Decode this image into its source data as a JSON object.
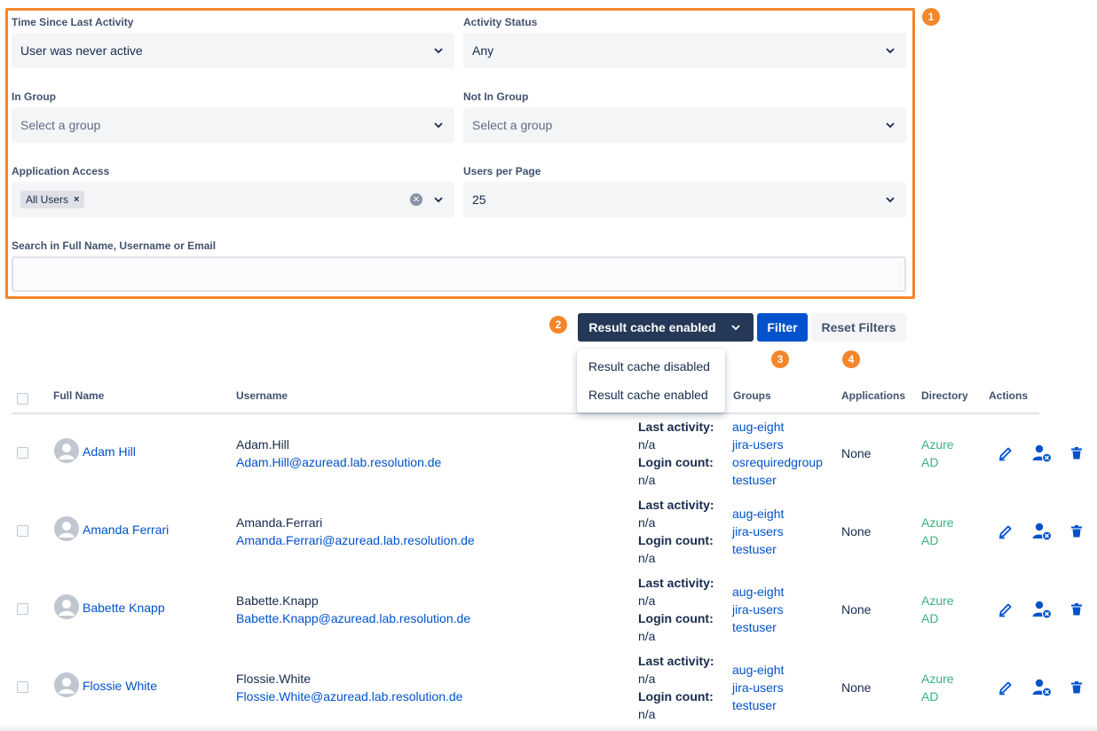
{
  "filters": {
    "time_since": {
      "label": "Time Since Last Activity",
      "value": "User was never active"
    },
    "activity_status": {
      "label": "Activity Status",
      "value": "Any"
    },
    "in_group": {
      "label": "In Group",
      "placeholder": "Select a group"
    },
    "not_in_group": {
      "label": "Not In Group",
      "placeholder": "Select a group"
    },
    "app_access": {
      "label": "Application Access",
      "chip": "All Users",
      "chip_remove": "×"
    },
    "users_per_page": {
      "label": "Users per Page",
      "value": "25"
    },
    "search": {
      "label": "Search in Full Name, Username or Email",
      "value": ""
    }
  },
  "callouts": [
    "1",
    "2",
    "3",
    "4"
  ],
  "toolbar": {
    "cache_button": "Result cache enabled",
    "filter_button": "Filter",
    "reset_button": "Reset Filters"
  },
  "cache_menu": [
    "Result cache disabled",
    "Result cache enabled"
  ],
  "table": {
    "headers": {
      "full_name": "Full Name",
      "username": "Username",
      "groups": "Groups",
      "applications": "Applications",
      "directory": "Directory",
      "actions": "Actions"
    },
    "activity_labels": {
      "last_activity": "Last activity:",
      "login_count": "Login count:"
    },
    "rows": [
      {
        "full_name": "Adam Hill",
        "username": "Adam.Hill",
        "email": "Adam.Hill@azuread.lab.resolution.de",
        "last_activity": "n/a",
        "login_count": "n/a",
        "groups": [
          "aug-eight",
          "jira-users",
          "osrequiredgroup",
          "testuser"
        ],
        "applications": "None",
        "directory": [
          "Azure",
          "AD"
        ]
      },
      {
        "full_name": "Amanda Ferrari",
        "username": "Amanda.Ferrari",
        "email": "Amanda.Ferrari@azuread.lab.resolution.de",
        "last_activity": "n/a",
        "login_count": "n/a",
        "groups": [
          "aug-eight",
          "jira-users",
          "testuser"
        ],
        "applications": "None",
        "directory": [
          "Azure",
          "AD"
        ]
      },
      {
        "full_name": "Babette Knapp",
        "username": "Babette.Knapp",
        "email": "Babette.Knapp@azuread.lab.resolution.de",
        "last_activity": "n/a",
        "login_count": "n/a",
        "groups": [
          "aug-eight",
          "jira-users",
          "testuser"
        ],
        "applications": "None",
        "directory": [
          "Azure",
          "AD"
        ]
      },
      {
        "full_name": "Flossie White",
        "username": "Flossie.White",
        "email": "Flossie.White@azuread.lab.resolution.de",
        "last_activity": "n/a",
        "login_count": "n/a",
        "groups": [
          "aug-eight",
          "jira-users",
          "testuser"
        ],
        "applications": "None",
        "directory": [
          "Azure",
          "AD"
        ]
      }
    ]
  },
  "colors": {
    "accent_orange": "#f5862a",
    "primary_blue": "#0052cc",
    "dark_button": "#253858",
    "directory_green": "#36b37e",
    "input_bg": "#f4f5f7"
  },
  "icons": [
    "chevron-down-icon",
    "clear-icon",
    "remove-chip-icon",
    "avatar-icon",
    "edit-pencil-icon",
    "remove-user-icon",
    "trash-icon"
  ]
}
